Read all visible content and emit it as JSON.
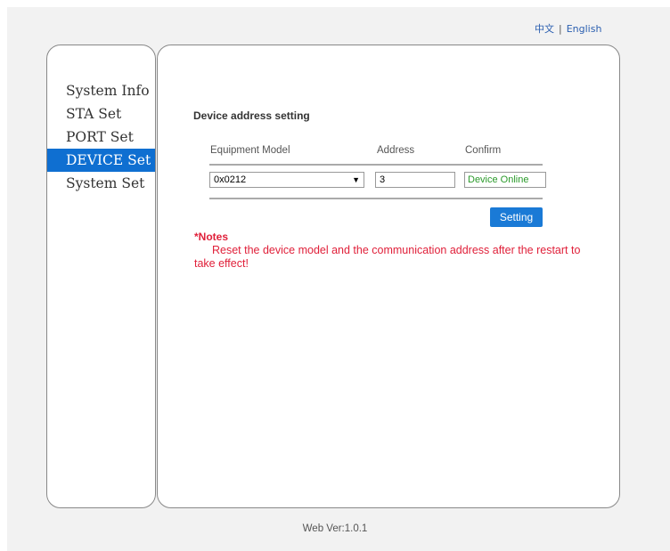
{
  "lang": {
    "chinese": "中文",
    "separator": "|",
    "english": "English"
  },
  "sidebar": {
    "items": [
      {
        "label": "System Info"
      },
      {
        "label": "STA Set"
      },
      {
        "label": "PORT Set"
      },
      {
        "label": "DEVICE Set",
        "active": true
      },
      {
        "label": "System Set"
      }
    ]
  },
  "main": {
    "title": "Device address setting",
    "table": {
      "headers": {
        "model": "Equipment Model",
        "address": "Address",
        "confirm": "Confirm"
      },
      "model_value": "0x0212",
      "address_value": "3",
      "status_value": "Device Online"
    },
    "button_label": "Setting",
    "notes_title": "*Notes",
    "notes_text": "Reset the device model and the communication address after the restart to take effect!"
  },
  "footer": {
    "version": "Web Ver:1.0.1"
  },
  "colors": {
    "accent": "#0f6fd1",
    "warning": "#e0203a",
    "online": "#2a9a2a"
  }
}
